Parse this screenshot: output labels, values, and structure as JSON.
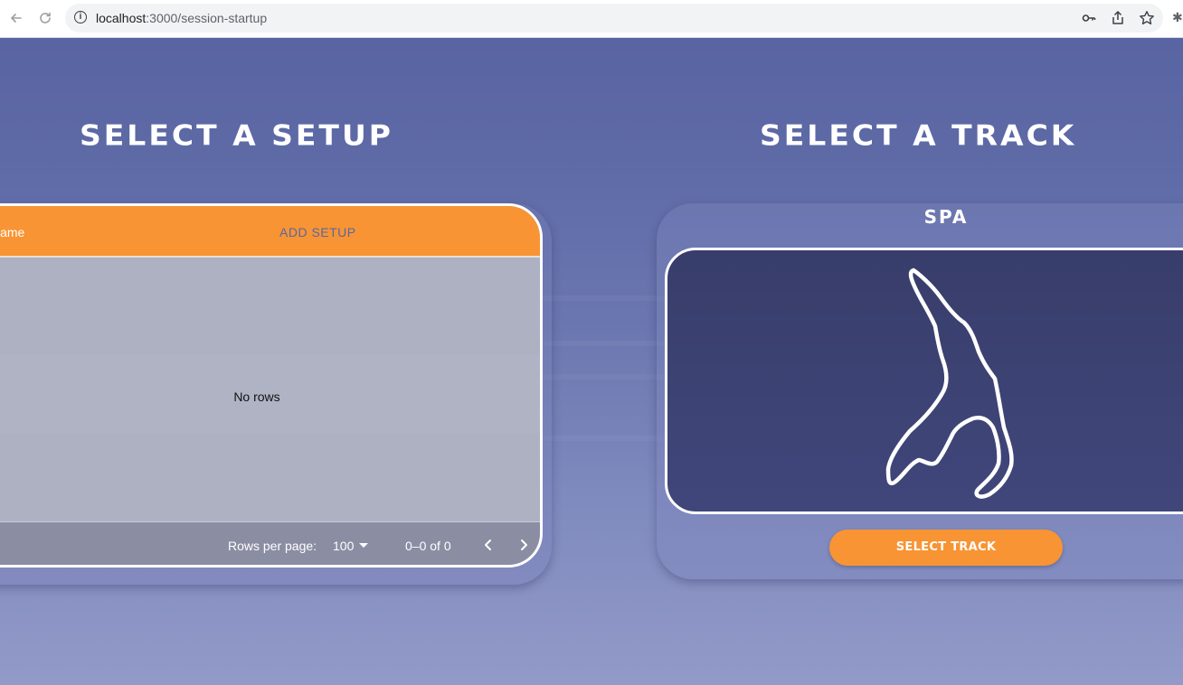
{
  "browser": {
    "url_host": "localhost",
    "url_path": ":3000/session-startup"
  },
  "setup_section": {
    "heading": "SELECT A SETUP",
    "grid": {
      "column_name": "Name",
      "add_button": "ADD SETUP",
      "empty_message": "No rows",
      "footer": {
        "rows_per_page_label": "Rows per page:",
        "rows_per_page_value": "100",
        "range_text": "0–0 of 0"
      }
    }
  },
  "track_section": {
    "heading": "SELECT A TRACK",
    "track_name": "SPA",
    "button_label": "SELECT TRACK"
  },
  "colors": {
    "accent_orange": "#f89433",
    "background_blue": "#5964a2",
    "track_panel": "#3b4070"
  },
  "icons": [
    "back-arrow-icon",
    "reload-icon",
    "info-icon",
    "key-icon",
    "share-icon",
    "star-icon",
    "extensions-icon",
    "dropdown-caret-icon",
    "chevron-left-icon",
    "chevron-right-icon",
    "track-layout-icon"
  ]
}
